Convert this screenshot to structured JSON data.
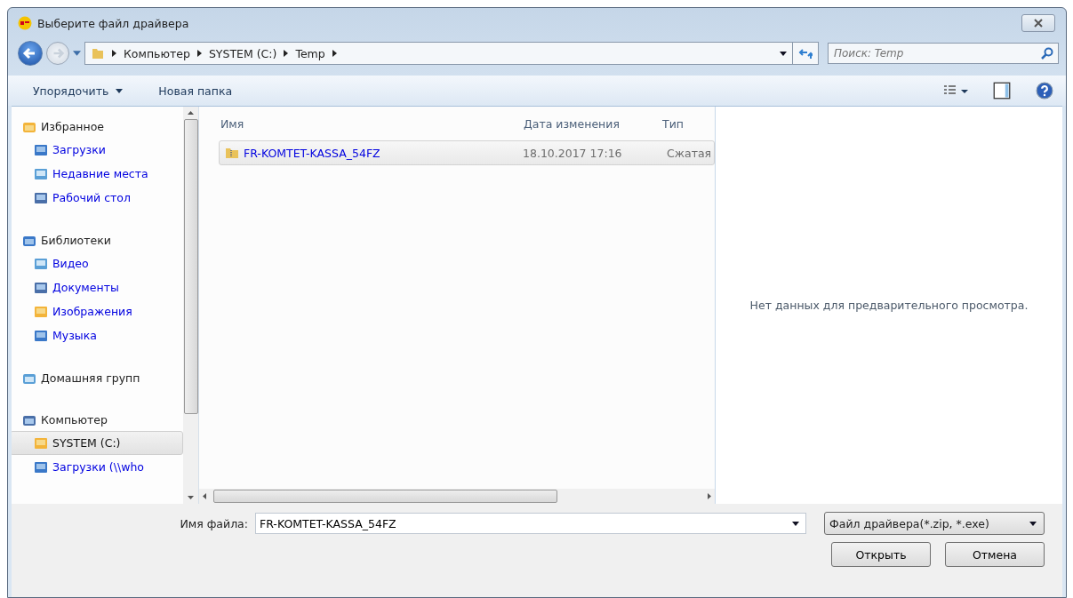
{
  "window": {
    "title": "Выберите файл драйвера"
  },
  "address_bar": {
    "path": [
      {
        "label": "Компьютер"
      },
      {
        "label": "SYSTEM (C:)"
      },
      {
        "label": "Temp"
      }
    ]
  },
  "search": {
    "placeholder": "Поиск: Temp"
  },
  "toolbar": {
    "organize": "Упорядочить",
    "new_folder": "Новая папка"
  },
  "sidebar": {
    "groups": [
      {
        "label": "Избранное",
        "children": [
          {
            "label": "Загрузки",
            "selected": false
          },
          {
            "label": "Недавние места",
            "selected": false
          },
          {
            "label": "Рабочий стол",
            "selected": false
          }
        ]
      },
      {
        "label": "Библиотеки",
        "children": [
          {
            "label": "Видео",
            "selected": false
          },
          {
            "label": "Документы",
            "selected": false
          },
          {
            "label": "Изображения",
            "selected": false
          },
          {
            "label": "Музыка",
            "selected": false
          }
        ]
      },
      {
        "label": "Домашняя групп"
      },
      {
        "label": "Компьютер",
        "children": [
          {
            "label": "SYSTEM (C:)",
            "selected": true
          },
          {
            "label": "Загрузки (\\\\who",
            "selected": false
          }
        ]
      }
    ]
  },
  "table": {
    "columns": [
      "Имя",
      "Дата изменения",
      "Тип"
    ],
    "rows": [
      {
        "name": "FR-KOMTET-KASSA_54FZ",
        "date": "18.10.2017 17:16",
        "type": "Сжатая",
        "selected": true
      }
    ]
  },
  "preview": {
    "message": "Нет данных для предварительного просмотра."
  },
  "file_name": {
    "label": "Имя файла:",
    "value": "FR-KOMTET-KASSA_54FZ"
  },
  "file_type": {
    "value": "Файл драйвера(*.zip, *.exe)"
  },
  "buttons": [
    "Открыть",
    "Отмена"
  ]
}
